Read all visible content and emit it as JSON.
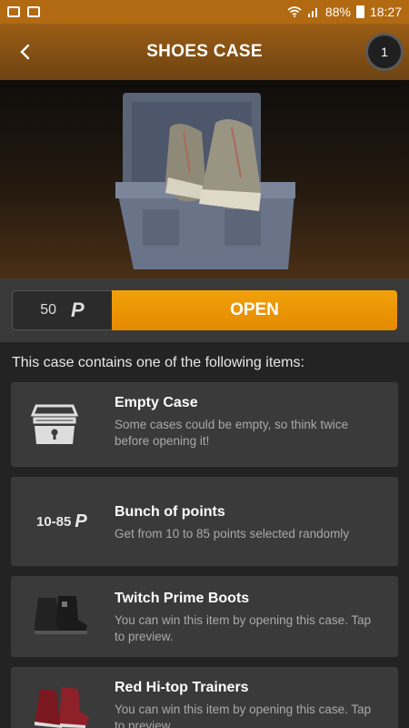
{
  "status_bar": {
    "battery": "88%",
    "time": "18:27"
  },
  "header": {
    "title": "SHOES CASE",
    "badge": "1"
  },
  "open_bar": {
    "price": "50",
    "open_label": "OPEN"
  },
  "contains_label": "This case contains one of the following items:",
  "items": [
    {
      "title": "Empty Case",
      "desc": "Some cases could be empty, so think twice before opening it!"
    },
    {
      "title": "Bunch of points",
      "range": "10-85",
      "desc": "Get from 10 to 85 points selected randomly"
    },
    {
      "title": "Twitch Prime Boots",
      "desc": "You can win this item by opening this case. Tap to preview."
    },
    {
      "title": "Red Hi-top Trainers",
      "desc": "You can win this item by opening this case. Tap to preview."
    }
  ],
  "colors": {
    "accent": "#f1a10b",
    "header": "#8a5214"
  }
}
